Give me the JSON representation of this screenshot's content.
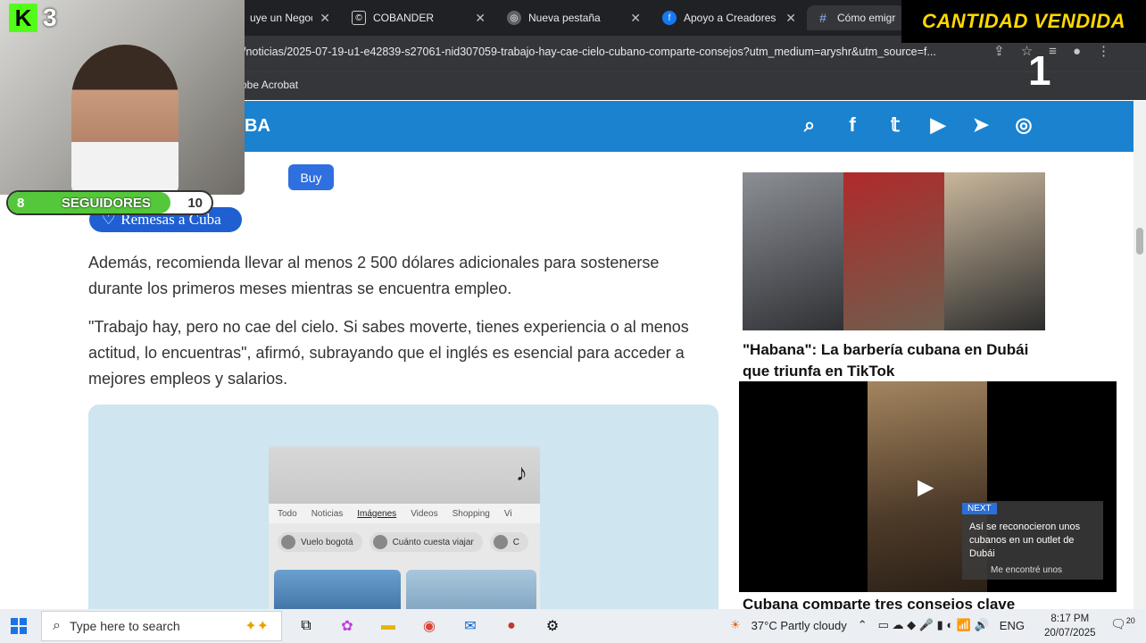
{
  "tabs": [
    {
      "title": "uye un Negoci",
      "icon": "page-icon"
    },
    {
      "title": "COBANDER",
      "icon": "cobander-icon"
    },
    {
      "title": "Nueva pestaña",
      "icon": "chrome-icon"
    },
    {
      "title": "Apoyo a Creadores D",
      "icon": "facebook-icon"
    },
    {
      "title": "Cómo emigrar",
      "icon": "hashtag-icon"
    }
  ],
  "address": {
    "url": "/noticias/2025-07-19-u1-e42839-s27061-nid307059-trabajo-hay-cae-cielo-cubano-comparte-consejos?utm_medium=aryshr&utm_source=f..."
  },
  "bookmarks": {
    "item": "obe Acrobat"
  },
  "site": {
    "logo": "BA"
  },
  "article": {
    "buy_label": "Buy",
    "remesas_label": "Remesas a Cuba",
    "para1": "Además, recomienda llevar al menos 2 500 dólares adicionales para sostenerse durante los primeros meses mientras se encuentra empleo.",
    "para2": "\"Trabajo hay, pero no cae del cielo. Si sabes moverte, tienes experiencia o al menos actitud, lo encuentras\", afirmó, subrayando que el inglés es esencial para acceder a mejores empleos y salarios.",
    "tiktok_tabs": [
      "Todo",
      "Noticias",
      "Imágenes",
      "Videos",
      "Shopping",
      "Vi"
    ],
    "tiktok_chips": [
      "Vuelo bogotá",
      "Cuánto cuesta viajar",
      "C"
    ]
  },
  "sidebar": {
    "story1_title": "\"Habana\": La barbería cubana en Dubái que triunfa en TikTok",
    "video_next_label": "NEXT",
    "video_next_title": "Así se reconocieron unos cubanos en un outlet de Dubái",
    "video_next_sub": "Me encontré unos",
    "story2_title": "Cubana comparte tres consejos clave"
  },
  "overlay": {
    "kick_level": "3",
    "followers_label": "SEGUIDORES",
    "followers_current": "8",
    "followers_goal": "10",
    "followers_progress": 0.8,
    "sales_label": "CANTIDAD VENDIDA",
    "sales_count": "1"
  },
  "taskbar": {
    "search_placeholder": "Type here to search",
    "weather": "37°C  Partly cloudy",
    "language": "ENG",
    "time": "8:17 PM",
    "date": "20/07/2025",
    "notifications": "20"
  },
  "colors": {
    "site_header": "#1a82cf",
    "kick_green": "#53fc18",
    "sales_yellow": "#ffd800"
  }
}
